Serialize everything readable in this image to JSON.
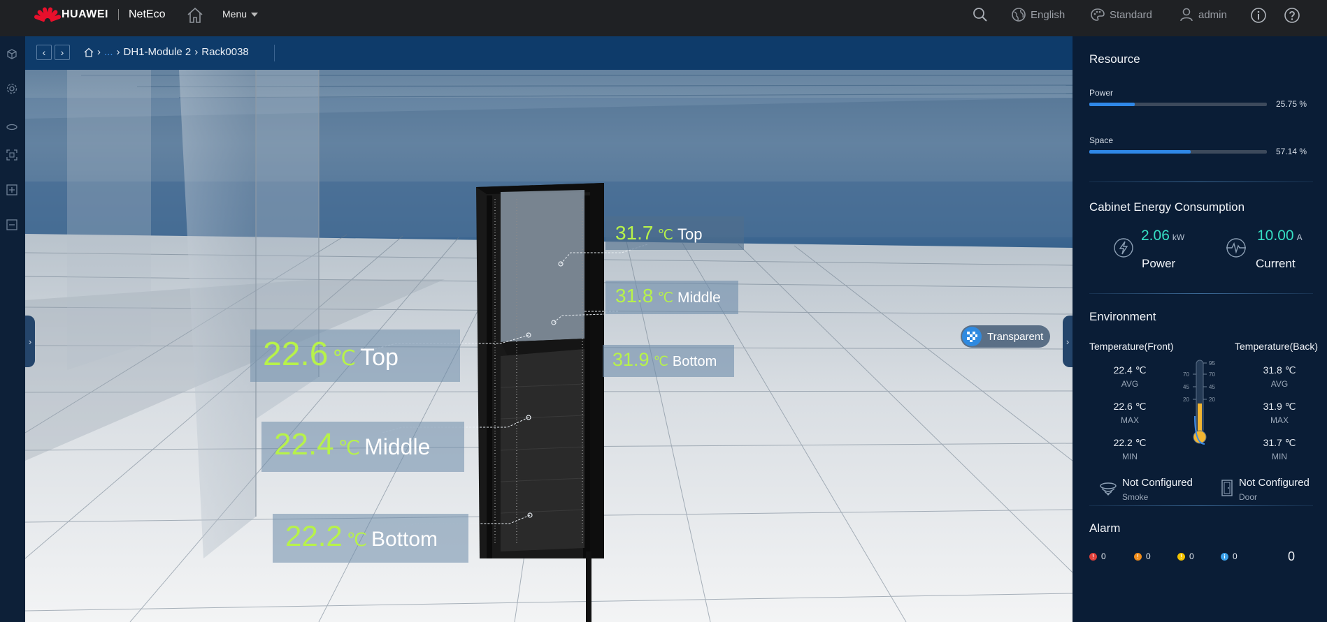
{
  "header": {
    "brand": "HUAWEI",
    "product": "NetEco",
    "menu_label": "Menu",
    "search_icon": "search-icon",
    "language_label": "English",
    "theme_label": "Standard",
    "user_label": "admin"
  },
  "breadcrumb": {
    "ellipsis": "...",
    "items": [
      "DH1-Module 2",
      "Rack0038"
    ]
  },
  "scene": {
    "front_labels": [
      {
        "value": "22.6",
        "unit": "℃",
        "position": "Top"
      },
      {
        "value": "22.4",
        "unit": "℃",
        "position": "Middle"
      },
      {
        "value": "22.2",
        "unit": "℃",
        "position": "Bottom"
      }
    ],
    "back_labels": [
      {
        "value": "31.7",
        "unit": "℃",
        "position": "Top"
      },
      {
        "value": "31.8",
        "unit": "℃",
        "position": "Middle"
      },
      {
        "value": "31.9",
        "unit": "℃",
        "position": "Bottom"
      }
    ],
    "transparent_label": "Transparent"
  },
  "panel": {
    "resource": {
      "title": "Resource",
      "power_label": "Power",
      "power_value": "25.75 %",
      "power_fraction": 0.2575,
      "space_label": "Space",
      "space_value": "57.14 %",
      "space_fraction": 0.5714
    },
    "energy": {
      "title": "Cabinet Energy Consumption",
      "power_value": "2.06",
      "power_unit": "kW",
      "power_label": "Power",
      "current_value": "10.00",
      "current_unit": "A",
      "current_label": "Current"
    },
    "environment": {
      "title": "Environment",
      "front_title": "Temperature(Front)",
      "back_title": "Temperature(Back)",
      "front": [
        {
          "value": "22.4 ℃",
          "label": "AVG"
        },
        {
          "value": "22.6 ℃",
          "label": "MAX"
        },
        {
          "value": "22.2 ℃",
          "label": "MIN"
        }
      ],
      "back": [
        {
          "value": "31.8 ℃",
          "label": "AVG"
        },
        {
          "value": "31.9 ℃",
          "label": "MAX"
        },
        {
          "value": "31.7 ℃",
          "label": "MIN"
        }
      ],
      "thermo_left_ticks": [
        "70",
        "45",
        "20"
      ],
      "thermo_right_ticks": [
        "95",
        "70",
        "45",
        "20"
      ],
      "smoke_status": "Not Configured",
      "smoke_label": "Smoke",
      "door_status": "Not Configured",
      "door_label": "Door"
    },
    "alarm": {
      "title": "Alarm",
      "critical": "0",
      "major": "0",
      "minor": "0",
      "warning": "0",
      "total": "0",
      "colors": {
        "critical": "#e0403a",
        "major": "#f08c1a",
        "minor": "#f2c200",
        "warning": "#3aa0e8"
      }
    }
  }
}
